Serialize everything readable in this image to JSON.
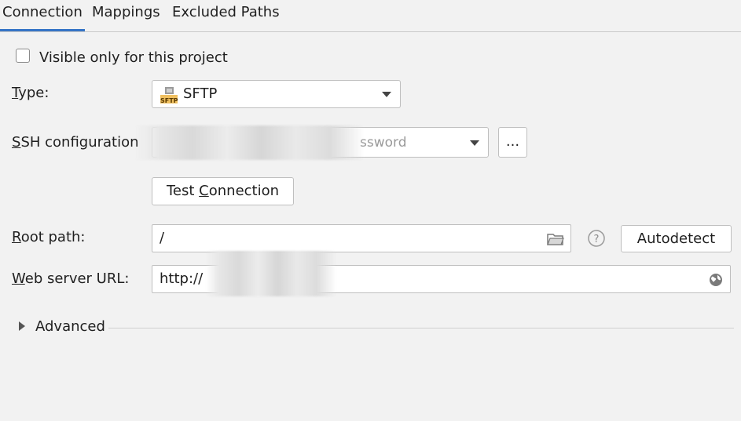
{
  "tabs": [
    {
      "label": "Connection",
      "active": true
    },
    {
      "label": "Mappings",
      "active": false
    },
    {
      "label": "Excluded Paths",
      "active": false
    }
  ],
  "visible_only": {
    "label": "Visible only for this project",
    "checked": false
  },
  "type": {
    "label_prefix": "T",
    "label_rest": "ype:",
    "value": "SFTP",
    "icon": "sftp-icon",
    "icon_text": "SFTP"
  },
  "ssh": {
    "label_prefix": "S",
    "label_rest": "SH configuration",
    "value_visible": "ssword",
    "more_label": "..."
  },
  "test_connection": {
    "pre": "Test ",
    "mnemonic": "C",
    "post": "onnection"
  },
  "root_path": {
    "label_prefix": "R",
    "label_rest": "oot path:",
    "value": "/",
    "autodetect_label": "Autodetect",
    "help_icon": "help-icon"
  },
  "web_server": {
    "label_prefix": "W",
    "label_rest": "eb server URL:",
    "value": "http://",
    "icon": "globe-icon"
  },
  "advanced": {
    "label": "Advanced",
    "expanded": false
  },
  "colors": {
    "accent": "#3574c6",
    "background": "#f2f2f2"
  }
}
